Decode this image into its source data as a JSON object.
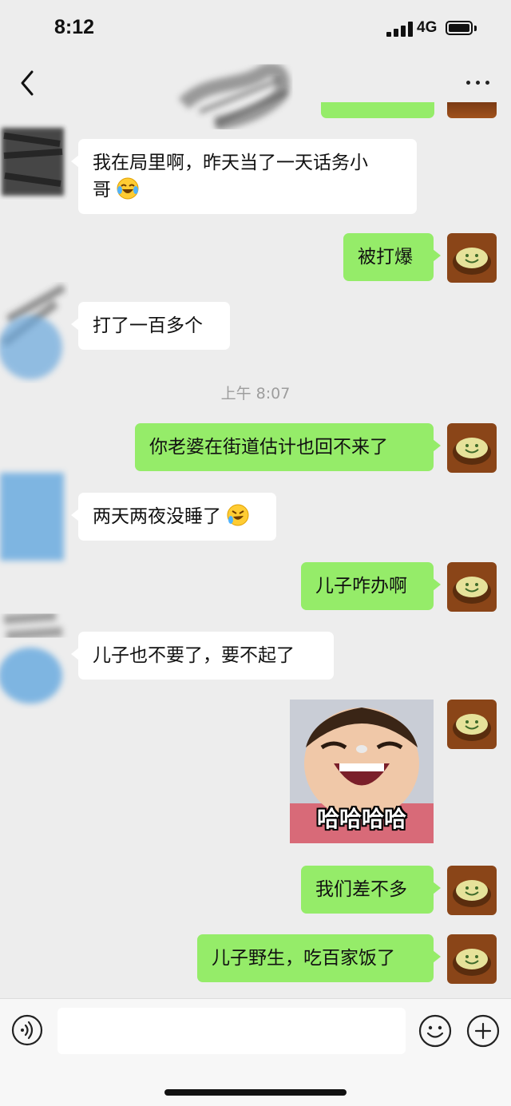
{
  "status_bar": {
    "time": "8:12",
    "network": "4G"
  },
  "nav": {
    "back_icon": "chevron-left-icon",
    "more_icon": "more-dots-icon"
  },
  "colors": {
    "background": "#ededed",
    "outgoing_bubble": "#95ec69",
    "incoming_bubble": "#ffffff",
    "timestamp": "#9d9d9d"
  },
  "messages": [
    {
      "from": "them",
      "line1": "我在局里啊，昨天当了一天话务小",
      "line2": "哥",
      "emoji": "tears-of-joy-emoji"
    },
    {
      "from": "me",
      "text": "被打爆"
    },
    {
      "from": "them",
      "text": "打了一百多个"
    },
    {
      "from": "me",
      "text": "你老婆在街道估计也回不来了"
    },
    {
      "from": "them",
      "text": "两天两夜没睡了",
      "emoji": "rolling-laugh-emoji"
    },
    {
      "from": "me",
      "text": "儿子咋办啊"
    },
    {
      "from": "them",
      "text": "儿子也不要了，要不起了"
    },
    {
      "from": "me",
      "type": "sticker",
      "caption": "哈哈哈哈"
    },
    {
      "from": "me",
      "text": "我们差不多"
    },
    {
      "from": "me",
      "text": "儿子野生，吃百家饭了"
    }
  ],
  "timestamp": "上午 8:07",
  "input_bar": {
    "voice_icon": "voice-icon",
    "emoji_icon": "emoji-face-icon",
    "add_icon": "plus-circle-icon"
  }
}
